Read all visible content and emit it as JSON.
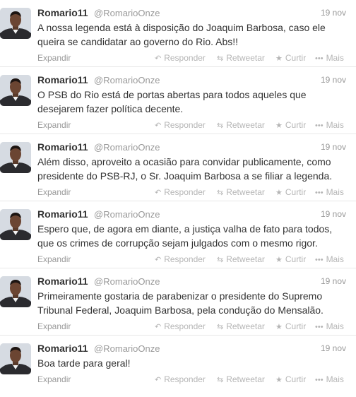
{
  "colors": {
    "text": "#333333",
    "meta": "#999999",
    "actions": "#b5b5b5",
    "divider": "#e8e8e8"
  },
  "icons": {
    "reply": "reply-arrow-icon",
    "retweet": "retweet-icon",
    "favorite": "star-icon",
    "more": "dots-icon"
  },
  "tweets": [
    {
      "name": "Romario11",
      "handle": "@RomarioOnze",
      "time": "19 nov",
      "text": "A nossa legenda está à disposição do Joaquim Barbosa, caso ele queira se candidatar ao governo do Rio. Abs!!",
      "expand": "Expandir",
      "reply": "Responder",
      "retweet": "Retweetar",
      "favorite": "Curtir",
      "more": "Mais"
    },
    {
      "name": "Romario11",
      "handle": "@RomarioOnze",
      "time": "19 nov",
      "text": "O PSB do Rio está de portas abertas para todos aqueles que desejarem fazer política decente.",
      "expand": "Expandir",
      "reply": "Responder",
      "retweet": "Retweetar",
      "favorite": "Curtir",
      "more": "Mais"
    },
    {
      "name": "Romario11",
      "handle": "@RomarioOnze",
      "time": "19 nov",
      "text": "Além disso, aproveito a ocasião para convidar publicamente, como presidente do PSB-RJ, o Sr. Joaquim Barbosa a se filiar a legenda.",
      "expand": "Expandir",
      "reply": "Responder",
      "retweet": "Retweetar",
      "favorite": "Curtir",
      "more": "Mais"
    },
    {
      "name": "Romario11",
      "handle": "@RomarioOnze",
      "time": "19 nov",
      "text": "Espero que, de agora em diante, a justiça valha de fato para todos, que os crimes de corrupção sejam julgados com o mesmo rigor.",
      "expand": "Expandir",
      "reply": "Responder",
      "retweet": "Retweetar",
      "favorite": "Curtir",
      "more": "Mais"
    },
    {
      "name": "Romario11",
      "handle": "@RomarioOnze",
      "time": "19 nov",
      "text": "Primeiramente gostaria de parabenizar o presidente do Supremo Tribunal Federal, Joaquim Barbosa, pela condução do Mensalão.",
      "expand": "Expandir",
      "reply": "Responder",
      "retweet": "Retweetar",
      "favorite": "Curtir",
      "more": "Mais"
    },
    {
      "name": "Romario11",
      "handle": "@RomarioOnze",
      "time": "19 nov",
      "text": "Boa tarde para geral!",
      "expand": "Expandir",
      "reply": "Responder",
      "retweet": "Retweetar",
      "favorite": "Curtir",
      "more": "Mais"
    }
  ]
}
